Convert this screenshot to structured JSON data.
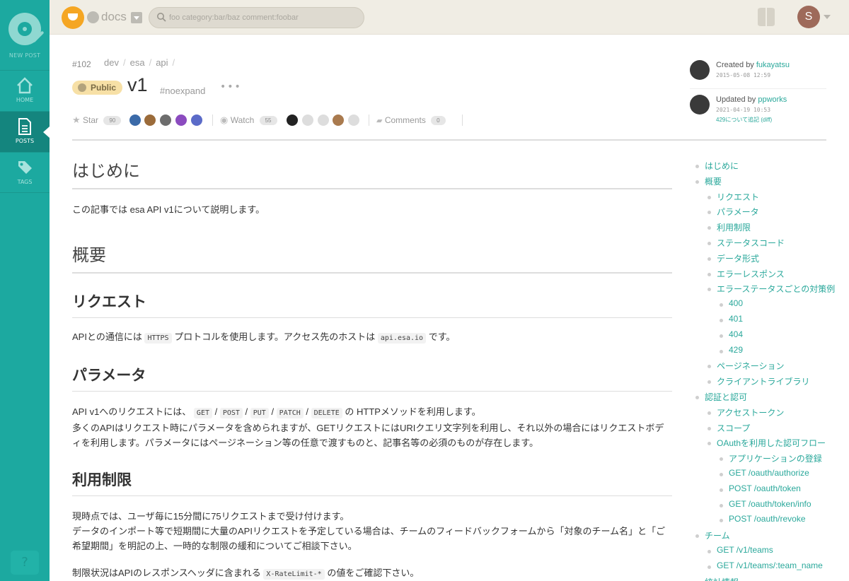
{
  "sidebar": {
    "new_post": "NEW POST",
    "items": [
      {
        "label": "HOME",
        "icon": "home-icon"
      },
      {
        "label": "POSTS",
        "icon": "document-icon",
        "active": true
      },
      {
        "label": "TAGS",
        "icon": "tag-icon"
      }
    ],
    "help": "?"
  },
  "header": {
    "team_name": "docs",
    "search_placeholder": "foo category:bar/baz comment:foobar",
    "user_initial": "S"
  },
  "post": {
    "number": "#102",
    "breadcrumbs": [
      "dev",
      "esa",
      "api"
    ],
    "visibility": "Public",
    "title": "v1",
    "tag": "#noexpand",
    "more": "•••",
    "star_label": "Star",
    "star_count": "90",
    "watch_label": "Watch",
    "watch_count": "55",
    "comments_label": "Comments",
    "comments_count": "0"
  },
  "meta": {
    "created_prefix": "Created by ",
    "created_by": "fukayatsu",
    "created_at": "2015-05-08 12:59",
    "updated_prefix": "Updated by ",
    "updated_by": "ppworks",
    "updated_at": "2021-04-19 10:53",
    "update_message": "429について追記 (diff)"
  },
  "content": {
    "h_intro": "はじめに",
    "p_intro": "この記事では esa API v1について説明します。",
    "h_overview": "概要",
    "h_request": "リクエスト",
    "p_request_1": "APIとの通信には",
    "p_request_code1": "HTTPS",
    "p_request_2": "プロトコルを使用します。アクセス先のホストは",
    "p_request_code2": "api.esa.io",
    "p_request_3": "です。",
    "h_params": "パラメータ",
    "p_params_1": "API v1へのリクエストには、",
    "p_params_m1": "GET",
    "p_params_m2": "POST",
    "p_params_m3": "PUT",
    "p_params_m4": "PATCH",
    "p_params_m5": "DELETE",
    "p_params_2": "の HTTPメソッドを利用します。",
    "p_params_3": "多くのAPIはリクエスト時にパラメータを含められますが、GETリクエストにはURIクエリ文字列を利用し、それ以外の場合にはリクエストボディを利用します。パラメータにはページネーション等の任意で渡すものと、記事名等の必須のものが存在します。",
    "h_limit": "利用制限",
    "p_limit_1": "現時点では、ユーザ毎に15分間に75リクエストまで受け付けます。",
    "p_limit_2": "データのインポート等で短期間に大量のAPIリクエストを予定している場合は、チームのフィードバックフォームから「対象のチーム名」と「ご希望期間」を明記の上、一時的な制限の緩和についてご相談下さい。",
    "p_limit_3a": "制限状況はAPIのレスポンスヘッダに含まれる",
    "p_limit_code": "X-RateLimit-*",
    "p_limit_3b": "の値をご確認下さい。"
  },
  "toc": [
    {
      "label": "はじめに",
      "level": 0
    },
    {
      "label": "概要",
      "level": 0
    },
    {
      "label": "リクエスト",
      "level": 1
    },
    {
      "label": "パラメータ",
      "level": 1
    },
    {
      "label": "利用制限",
      "level": 1
    },
    {
      "label": "ステータスコード",
      "level": 1
    },
    {
      "label": "データ形式",
      "level": 1
    },
    {
      "label": "エラーレスポンス",
      "level": 1
    },
    {
      "label": "エラーステータスごとの対策例",
      "level": 1
    },
    {
      "label": "400",
      "level": 2
    },
    {
      "label": "401",
      "level": 2
    },
    {
      "label": "404",
      "level": 2
    },
    {
      "label": "429",
      "level": 2
    },
    {
      "label": "ページネーション",
      "level": 1
    },
    {
      "label": "クライアントライブラリ",
      "level": 1
    },
    {
      "label": "認証と認可",
      "level": 0
    },
    {
      "label": "アクセストークン",
      "level": 1
    },
    {
      "label": "スコープ",
      "level": 1
    },
    {
      "label": "OAuthを利用した認可フロー",
      "level": 1
    },
    {
      "label": "アプリケーションの登録",
      "level": 2
    },
    {
      "label": "GET /oauth/authorize",
      "level": 2
    },
    {
      "label": "POST /oauth/token",
      "level": 2
    },
    {
      "label": "GET /oauth/token/info",
      "level": 2
    },
    {
      "label": "POST /oauth/revoke",
      "level": 2
    },
    {
      "label": "チーム",
      "level": 0
    },
    {
      "label": "GET /v1/teams",
      "level": 1
    },
    {
      "label": "GET /v1/teams/:team_name",
      "level": 1
    },
    {
      "label": "統計情報",
      "level": 0
    }
  ]
}
